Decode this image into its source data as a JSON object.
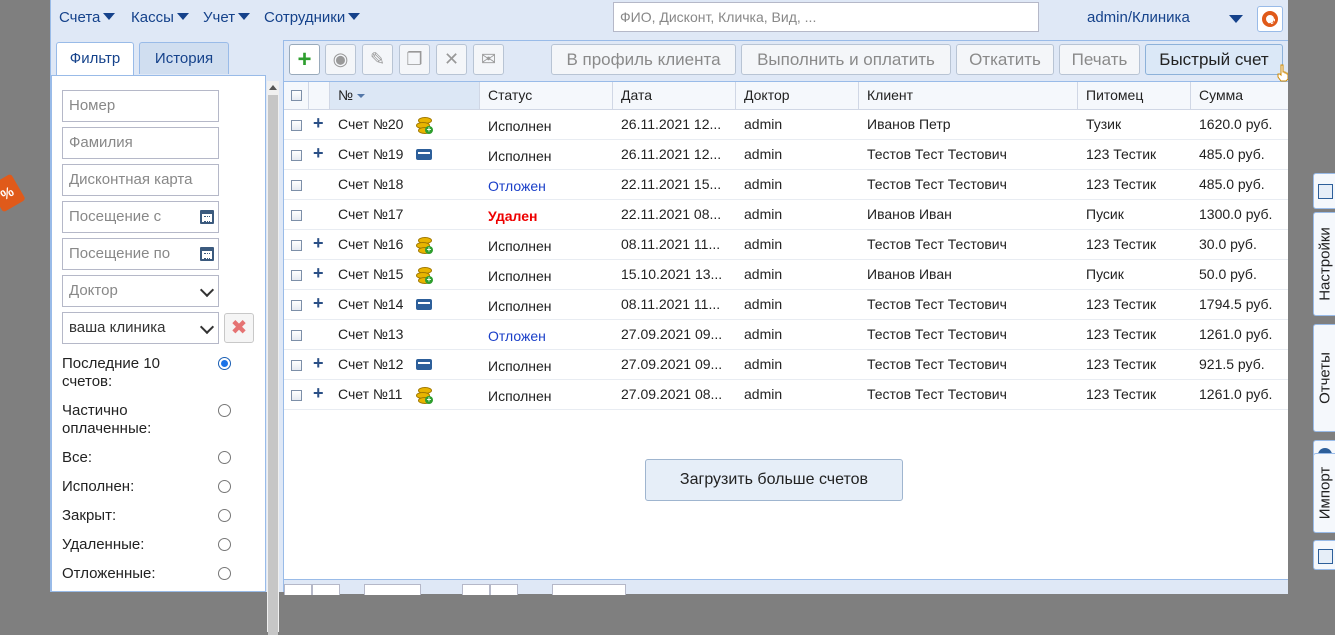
{
  "menu": {
    "items": [
      {
        "label": "Счета"
      },
      {
        "label": "Кассы"
      },
      {
        "label": "Учет"
      },
      {
        "label": "Сотрудники"
      }
    ],
    "search_placeholder": "ФИО, Дисконт, Кличка, Вид, ...",
    "user": "admin/Клиника"
  },
  "filter": {
    "tabs": [
      {
        "label": "Фильтр",
        "active": true
      },
      {
        "label": "История",
        "active": false
      }
    ],
    "fields": {
      "number": "Номер",
      "surname": "Фамилия",
      "discount_card": "Дисконтная карта",
      "visit_from": "Посещение с",
      "visit_to": "Посещение по",
      "doctor": "Доктор",
      "clinic": "ваша клиника"
    },
    "clear_label": "✖",
    "radios": [
      {
        "label": "Последние 10 счетов:",
        "checked": true
      },
      {
        "label": "Частично оплаченные:",
        "checked": false
      },
      {
        "label": "Все:",
        "checked": false
      },
      {
        "label": "Исполнен:",
        "checked": false
      },
      {
        "label": "Закрыт:",
        "checked": false
      },
      {
        "label": "Удаленные:",
        "checked": false
      },
      {
        "label": "Отложенные:",
        "checked": false
      }
    ]
  },
  "toolbar": {
    "add": "+",
    "view": "◉",
    "edit": "✎",
    "copy": "❐",
    "delete": "✕",
    "mail": "✉",
    "to_client_profile": "В профиль клиента",
    "execute_and_pay": "Выполнить и оплатить",
    "rollback": "Откатить",
    "print": "Печать",
    "quick_invoice": "Быстрый счет"
  },
  "grid": {
    "columns": {
      "number": "№",
      "status": "Статус",
      "date": "Дата",
      "doctor": "Доктор",
      "client": "Клиент",
      "pet": "Питомец",
      "sum": "Сумма"
    },
    "rows": [
      {
        "number": "Счет №20",
        "expand": "+",
        "icon": "coins-icon",
        "status": "Исполнен",
        "status_kind": "done",
        "date": "26.11.2021 12...",
        "doctor": "admin",
        "client": "Иванов Петр",
        "pet": "Тузик",
        "sum": "1620.0 руб."
      },
      {
        "number": "Счет №19",
        "expand": "+",
        "icon": "card-icon",
        "status": "Исполнен",
        "status_kind": "done",
        "date": "26.11.2021 12...",
        "doctor": "admin",
        "client": "Тестов Тест Тестович",
        "pet": "123 Тестик",
        "sum": "485.0 руб."
      },
      {
        "number": "Счет №18",
        "expand": "",
        "icon": "",
        "status": "Отложен",
        "status_kind": "wait",
        "date": "22.11.2021 15...",
        "doctor": "admin",
        "client": "Тестов Тест Тестович",
        "pet": "123 Тестик",
        "sum": "485.0 руб."
      },
      {
        "number": "Счет №17",
        "expand": "",
        "icon": "",
        "status": "Удален",
        "status_kind": "del",
        "date": "22.11.2021 08...",
        "doctor": "admin",
        "client": "Иванов Иван",
        "pet": "Пусик",
        "sum": "1300.0 руб."
      },
      {
        "number": "Счет №16",
        "expand": "+",
        "icon": "coins-icon",
        "status": "Исполнен",
        "status_kind": "done",
        "date": "08.11.2021 11...",
        "doctor": "admin",
        "client": "Тестов Тест Тестович",
        "pet": "123 Тестик",
        "sum": "30.0 руб."
      },
      {
        "number": "Счет №15",
        "expand": "+",
        "icon": "coins-icon",
        "status": "Исполнен",
        "status_kind": "done",
        "date": "15.10.2021 13...",
        "doctor": "admin",
        "client": "Иванов Иван",
        "pet": "Пусик",
        "sum": "50.0 руб."
      },
      {
        "number": "Счет №14",
        "expand": "+",
        "icon": "card-icon",
        "status": "Исполнен",
        "status_kind": "done",
        "date": "08.11.2021 11...",
        "doctor": "admin",
        "client": "Тестов Тест Тестович",
        "pet": "123 Тестик",
        "sum": "1794.5 руб."
      },
      {
        "number": "Счет №13",
        "expand": "",
        "icon": "",
        "status": "Отложен",
        "status_kind": "wait",
        "date": "27.09.2021 09...",
        "doctor": "admin",
        "client": "Тестов Тест Тестович",
        "pet": "123 Тестик",
        "sum": "1261.0 руб."
      },
      {
        "number": "Счет №12",
        "expand": "+",
        "icon": "card-icon",
        "status": "Исполнен",
        "status_kind": "done",
        "date": "27.09.2021 09...",
        "doctor": "admin",
        "client": "Тестов Тест Тестович",
        "pet": "123 Тестик",
        "sum": "921.5 руб."
      },
      {
        "number": "Счет №11",
        "expand": "+",
        "icon": "coins-icon",
        "status": "Исполнен",
        "status_kind": "done",
        "date": "27.09.2021 08...",
        "doctor": "admin",
        "client": "Тестов Тест Тестович",
        "pet": "123 Тестик",
        "sum": "1261.0 руб."
      }
    ],
    "load_more": "Загрузить больше счетов"
  },
  "side_tabs": {
    "settings": "Настройки",
    "reports": "Отчеты",
    "import": "Импорт"
  },
  "colors": {
    "accent": "#15428b",
    "status_wait": "#1a3fc8",
    "status_deleted": "#e00000",
    "add_green": "#2e9e2e"
  }
}
